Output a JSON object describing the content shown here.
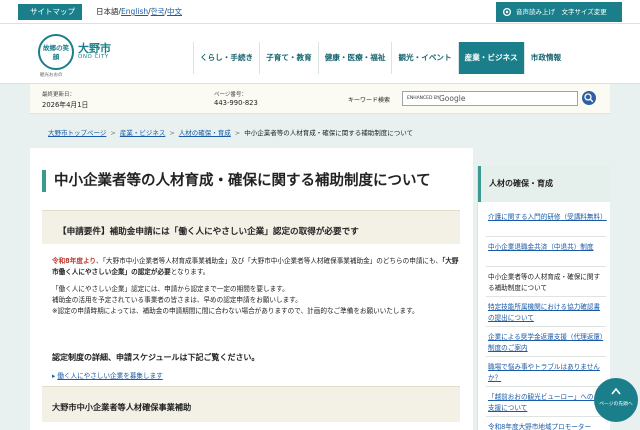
{
  "topbar": {
    "sitemap": "サイトマップ",
    "lang_current": "日本語",
    "lang_sep1": "/",
    "lang_en": "English",
    "lang_sep2": "/",
    "lang_ko": "한국",
    "lang_sep3": "/",
    "lang_zh": "中文",
    "voice_button": "音声読み上げ　文字サイズ変更"
  },
  "header": {
    "logo_text": "故郷の笑顔",
    "logo_sub": "観光おおの",
    "city_name": "大野市",
    "city_name_en": "ONO CITY",
    "nav": [
      {
        "label": "くらし・手続き"
      },
      {
        "label": "子育て・教育"
      },
      {
        "label": "健康・医療・福祉"
      },
      {
        "label": "観光・イベント"
      },
      {
        "label": "産業・ビジネス"
      },
      {
        "label": "市政情報"
      }
    ],
    "active_nav_color": "#1b7f8b"
  },
  "info": {
    "updated_label": "最終更新日：",
    "updated_date": "2026年4月1日",
    "page_no_label": "ページ番号：",
    "page_no": "443-990-823",
    "keyword_label": "キーワード検索",
    "search_enhanced": "ENHANCED BY",
    "search_google": "Google"
  },
  "breadcrumb": {
    "items": [
      "大野市トップページ",
      "産業・ビジネス",
      "人材の確保・育成"
    ],
    "current": "中小企業者等の人材育成・確保に関する補助制度について",
    "separator": ">"
  },
  "main": {
    "title": "中小企業者等の人材育成・確保に関する補助制度について",
    "req_heading": "【申請要件】補助金申請には「働く人にやさしい企業」認定の取得が必要です",
    "p1_red": "令和8年度より",
    "p1_rest": "、「大野市中小企業者等人材育成事業補助金」及び「大野市中小企業者等人材確保事業補助金」のどちらの申請にも、",
    "p1_bold": "「大野市働く人にやさしい企業」の認定が必要",
    "p1_end": "となります。",
    "p2_line1": "「働く人にやさしい企業」認定には、申請から認定まで一定の期間を要します。",
    "p2_line2": "補助金の活用を予定されている事業者の皆さまは、早めの認定申請をお願いします。",
    "p2_line3": "※認定の申請時期によっては、補助金の申請期間に間に合わない場合がありますので、計画的なご準備をお願いいたします。",
    "schedule_heading": "認定制度の詳細、申請スケジュールは下記ご覧ください。",
    "link_bullet": "▸",
    "link_text": "働く人にやさしい企業を募集します",
    "sub_heading": "大野市中小企業者等人材確保事業補助"
  },
  "sidebar": {
    "heading": "人材の確保・育成",
    "items": [
      {
        "label": "介護に関する入門的研修（受講料無料）"
      },
      {
        "label": "中小企業退職金共済（中退共）制度"
      },
      {
        "label": "中小企業者等の人材育成・確保に関する補助制度について"
      },
      {
        "label": "特定技能所属機関における協力確認書の提出について"
      },
      {
        "label": "企業による奨学金返還支援（代理返還）制度のご案内"
      },
      {
        "label": "職場で悩み事やトラブルはありませんか？"
      },
      {
        "label": "「越前おおの観光ビューロー」へのご支援について"
      },
      {
        "label": "令和8年度大野市地域プロモーター"
      }
    ]
  },
  "float_button": {
    "text": "ページの先頭へ"
  }
}
